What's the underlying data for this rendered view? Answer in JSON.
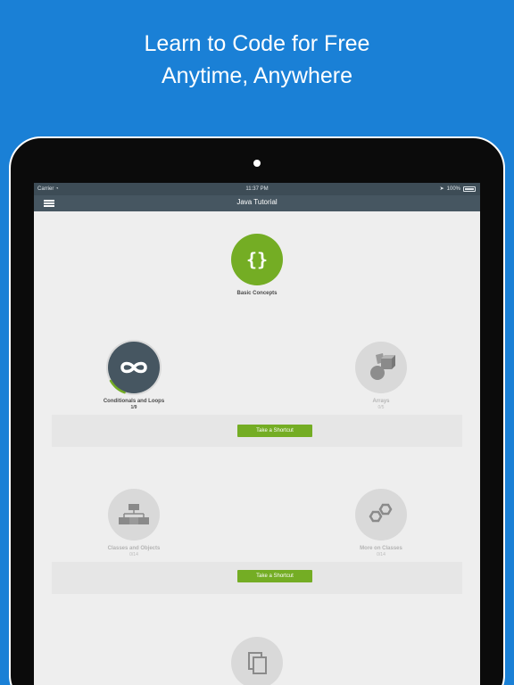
{
  "promo": {
    "line1": "Learn to Code for Free",
    "line2": "Anytime, Anywhere"
  },
  "status_bar": {
    "carrier": "Carrier",
    "time": "11:37 PM",
    "battery": "100%"
  },
  "nav": {
    "title": "Java Tutorial",
    "menu_icon": "hamburger-menu-icon"
  },
  "lessons": [
    {
      "title": "Basic Concepts",
      "progress": "",
      "icon": "curly-braces-icon",
      "state": "completed"
    },
    {
      "title": "Conditionals and Loops",
      "progress": "1/9",
      "icon": "infinity-icon",
      "state": "in-progress",
      "fraction": 0.11
    },
    {
      "title": "Arrays",
      "progress": "0/5",
      "icon": "shapes-icon",
      "state": "locked"
    },
    {
      "title": "Classes and Objects",
      "progress": "0/14",
      "icon": "class-hierarchy-icon",
      "state": "locked"
    },
    {
      "title": "More on Classes",
      "progress": "0/14",
      "icon": "hexagons-icon",
      "state": "locked"
    },
    {
      "title": "",
      "progress": "",
      "icon": "copy-pages-icon",
      "state": "locked"
    }
  ],
  "shortcuts": [
    {
      "label": "Take a Shortcut"
    },
    {
      "label": "Take a Shortcut"
    }
  ],
  "colors": {
    "background": "#1a80d6",
    "accent_green": "#74ad24",
    "nav_dark": "#465661"
  }
}
